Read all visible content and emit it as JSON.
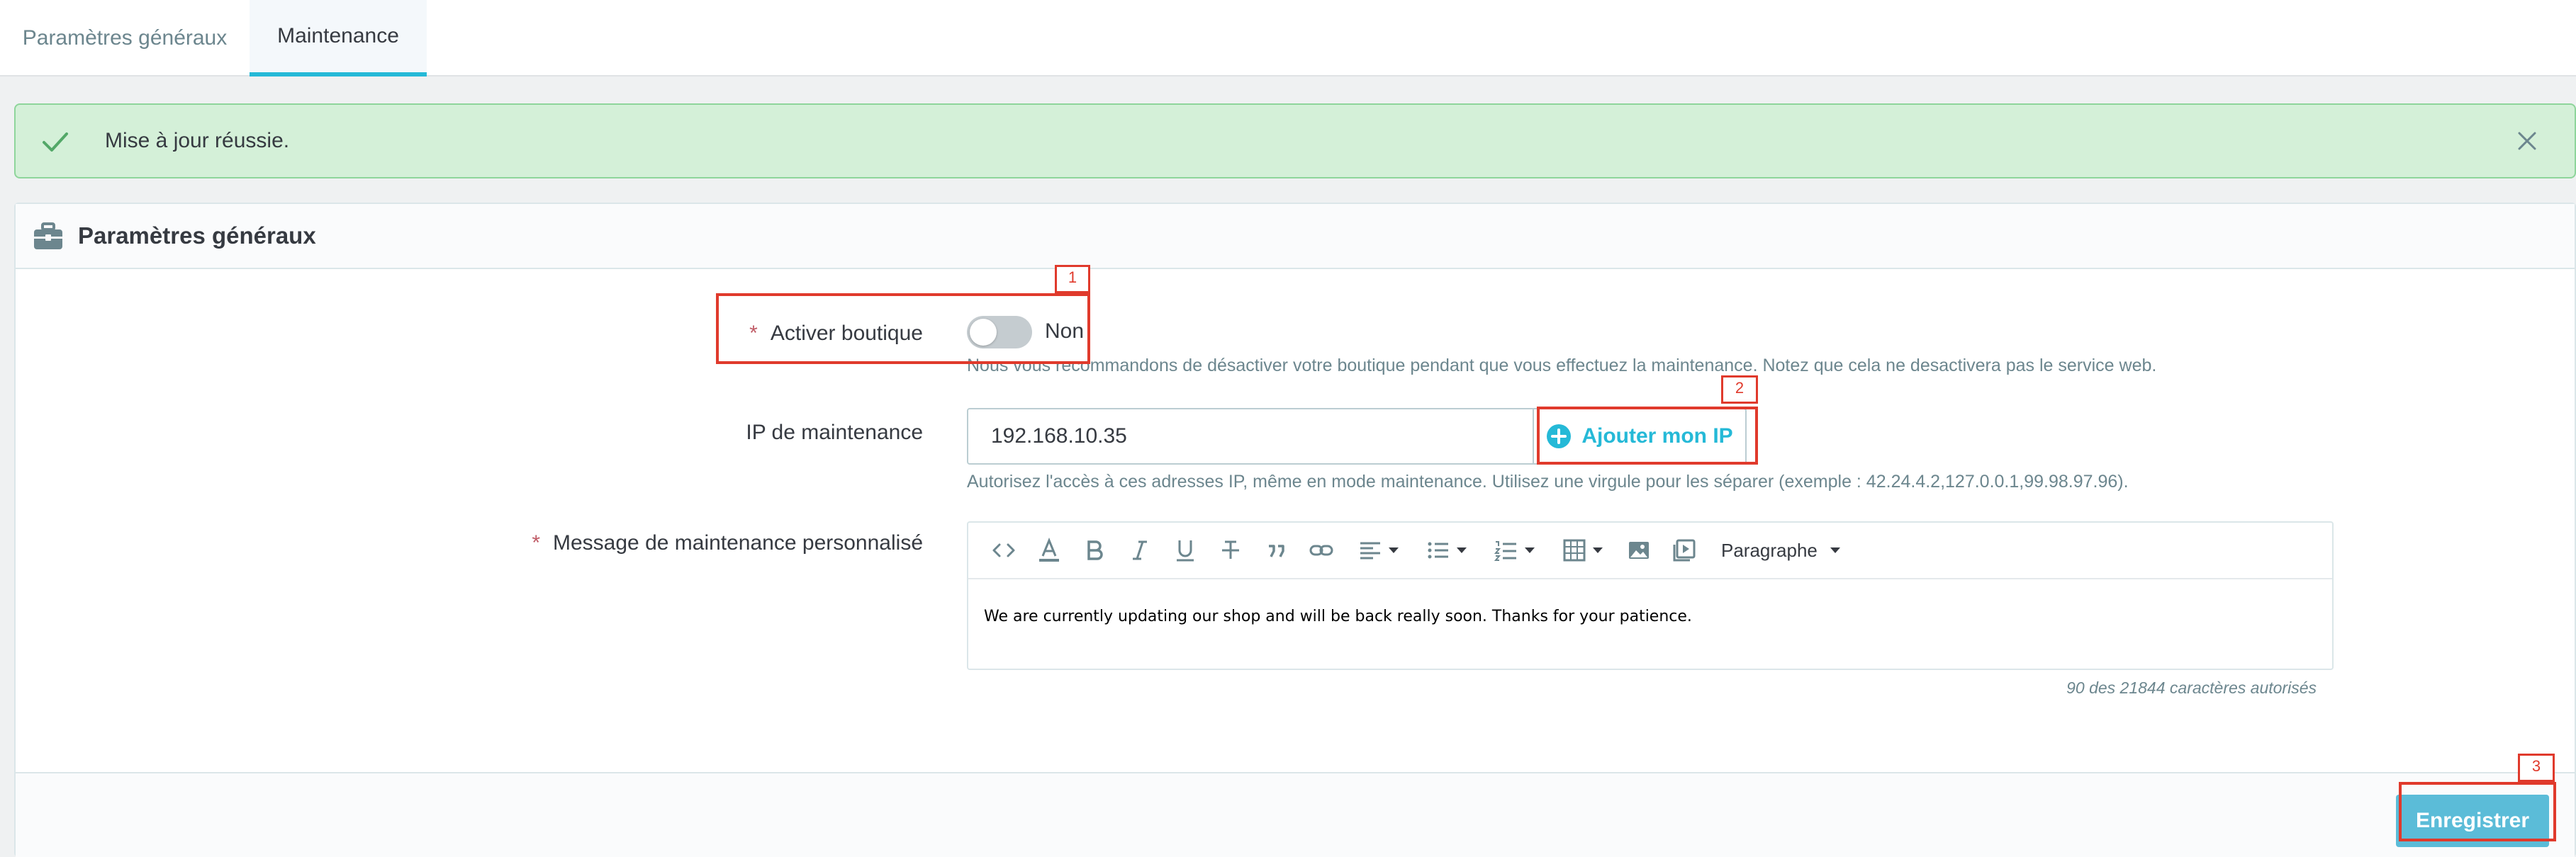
{
  "tabs": [
    {
      "label": "Paramètres généraux",
      "active": false
    },
    {
      "label": "Maintenance",
      "active": true
    }
  ],
  "alert": {
    "message": "Mise à jour réussie."
  },
  "panel": {
    "title": "Paramètres généraux",
    "enable_shop": {
      "label": "Activer boutique",
      "value": "Non",
      "help": "Nous vous recommandons de désactiver votre boutique pendant que vous effectuez la maintenance. Notez que cela ne desactivera pas le service web."
    },
    "maintenance_ip": {
      "label": "IP de maintenance",
      "value": "192.168.10.35",
      "add_button": "Ajouter mon IP",
      "help": "Autorisez l'accès à ces adresses IP, même en mode maintenance. Utilisez une virgule pour les séparer (exemple : 42.24.4.2,127.0.0.1,99.98.97.96)."
    },
    "custom_message": {
      "label": "Message de maintenance personnalisé",
      "paragraph_select": "Paragraphe",
      "content": "We are currently updating our shop and will be back really soon. Thanks for your patience.",
      "counter": "90 des 21844 caractères autorisés"
    },
    "save_button": "Enregistrer"
  },
  "annotations": [
    "1",
    "2",
    "3"
  ],
  "colors": {
    "accent": "#25b9d7",
    "success_bg": "#d4f0d8",
    "annotation": "#e03a2c"
  }
}
